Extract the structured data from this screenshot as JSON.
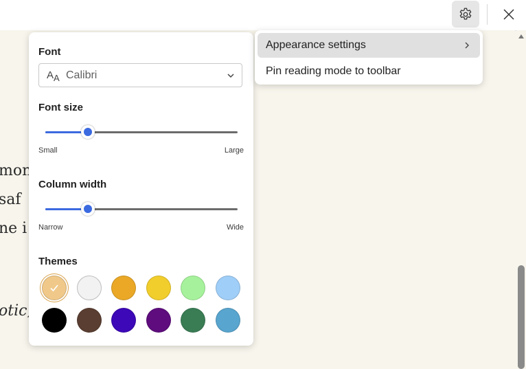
{
  "reading": {
    "lines": [
      "mon",
      "saf",
      "ne i",
      "otic,"
    ]
  },
  "toolbar": {
    "settings_icon": "gear-icon",
    "close_icon": "close-icon"
  },
  "panel": {
    "font": {
      "label": "Font",
      "value": "Calibri",
      "icon": "font-aa-icon"
    },
    "font_size": {
      "label": "Font size",
      "min_label": "Small",
      "max_label": "Large",
      "level": 0.22
    },
    "column_width": {
      "label": "Column width",
      "min_label": "Narrow",
      "max_label": "Wide",
      "level": 0.22
    },
    "themes": {
      "label": "Themes",
      "selected_index": 0,
      "colors": [
        "#f0c98a",
        "#f2f2f2",
        "#eaa826",
        "#f2ce2c",
        "#a6f29c",
        "#9fcef8",
        "#000000",
        "#5a3e31",
        "#3c08b8",
        "#5e0c7e",
        "#3a7d55",
        "#58a5cf"
      ]
    }
  },
  "menu": {
    "items": [
      {
        "label": "Appearance settings",
        "has_submenu": true
      },
      {
        "label": "Pin reading mode to toolbar",
        "has_submenu": false
      }
    ]
  },
  "colors": {
    "accent": "#3b6ae0",
    "page_background": "#f7f5ec"
  }
}
